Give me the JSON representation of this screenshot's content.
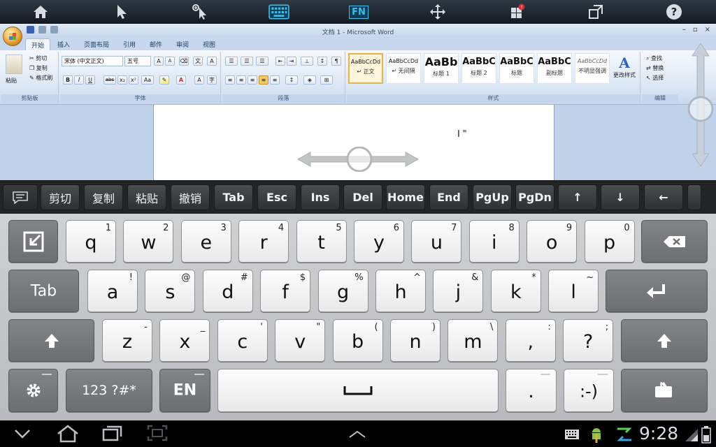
{
  "toolbar": {
    "icons": [
      "home-icon",
      "pointer-icon",
      "zoom-pointer-icon",
      "keyboard-icon",
      "fn-icon",
      "move-icon",
      "windows-icon",
      "monitor-icon",
      "help-icon"
    ],
    "fn_label": "FN",
    "help_label": "?",
    "active_color": "#36c1f0"
  },
  "word": {
    "window_title": "文档 1 - Microsoft Word",
    "tabs": [
      "开始",
      "插入",
      "页面布局",
      "引用",
      "邮件",
      "审阅",
      "视图"
    ],
    "clipboard": {
      "paste": "粘贴",
      "cut": "剪切",
      "copy": "复制",
      "format_painter": "格式刷",
      "group": "剪贴板"
    },
    "font": {
      "name": "宋体 (中文正文)",
      "size": "五号",
      "group": "字体",
      "grow": "A",
      "shrink": "A",
      "aa": "Aa",
      "bold": "B",
      "italic": "I",
      "underline": "U",
      "strike": "abc",
      "sub": "x₂",
      "sup": "x²"
    },
    "paragraph": {
      "group": "段落"
    },
    "styles": {
      "group": "样式",
      "items": [
        {
          "preview": "AaBbCcDd",
          "name": "↵ 正文"
        },
        {
          "preview": "AaBbCcDd",
          "name": "↵ 无间隔"
        },
        {
          "preview": "AaBb",
          "name": "标题 1"
        },
        {
          "preview": "AaBbC",
          "name": "标题 2"
        },
        {
          "preview": "AaBbC",
          "name": "标题"
        },
        {
          "preview": "AaBbC",
          "name": "副标题"
        },
        {
          "preview": "AaBbCcDd",
          "name": "不明显强调"
        }
      ],
      "change": "更改样式"
    },
    "editing": {
      "group": "编辑",
      "find": "查找",
      "replace": "替换",
      "select": "选择"
    }
  },
  "shortcuts": [
    "剪切",
    "复制",
    "粘贴",
    "撤销",
    "Tab",
    "Esc",
    "Ins",
    "Del",
    "Home",
    "End",
    "PgUp",
    "PgDn",
    "↑",
    "↓",
    "←"
  ],
  "keyboard": {
    "row1": [
      {
        "k": "q",
        "s": "1"
      },
      {
        "k": "w",
        "s": "2"
      },
      {
        "k": "e",
        "s": "3"
      },
      {
        "k": "r",
        "s": "4"
      },
      {
        "k": "t",
        "s": "5"
      },
      {
        "k": "y",
        "s": "6"
      },
      {
        "k": "u",
        "s": "7"
      },
      {
        "k": "i",
        "s": "8"
      },
      {
        "k": "o",
        "s": "9"
      },
      {
        "k": "p",
        "s": "0"
      }
    ],
    "row2": [
      {
        "k": "a",
        "s": "!"
      },
      {
        "k": "s",
        "s": "@"
      },
      {
        "k": "d",
        "s": "#"
      },
      {
        "k": "f",
        "s": "$"
      },
      {
        "k": "g",
        "s": "%"
      },
      {
        "k": "h",
        "s": "^"
      },
      {
        "k": "j",
        "s": "&"
      },
      {
        "k": "k",
        "s": "*"
      },
      {
        "k": "l",
        "s": "~"
      }
    ],
    "row3": [
      {
        "k": "z",
        "s": "-"
      },
      {
        "k": "x",
        "s": "_"
      },
      {
        "k": "c",
        "s": "'"
      },
      {
        "k": "v",
        "s": "\""
      },
      {
        "k": "b",
        "s": "("
      },
      {
        "k": "n",
        "s": ")"
      },
      {
        "k": "m",
        "s": "\\"
      },
      {
        "k": ",",
        "s": ":"
      },
      {
        "k": "?",
        "s": ";"
      }
    ],
    "tab_label": "Tab",
    "symbols_label": "123 ?#*",
    "lang_label": "EN",
    "period_label": ".",
    "emoticon_label": ":-)"
  },
  "status": {
    "time": "9:28"
  }
}
